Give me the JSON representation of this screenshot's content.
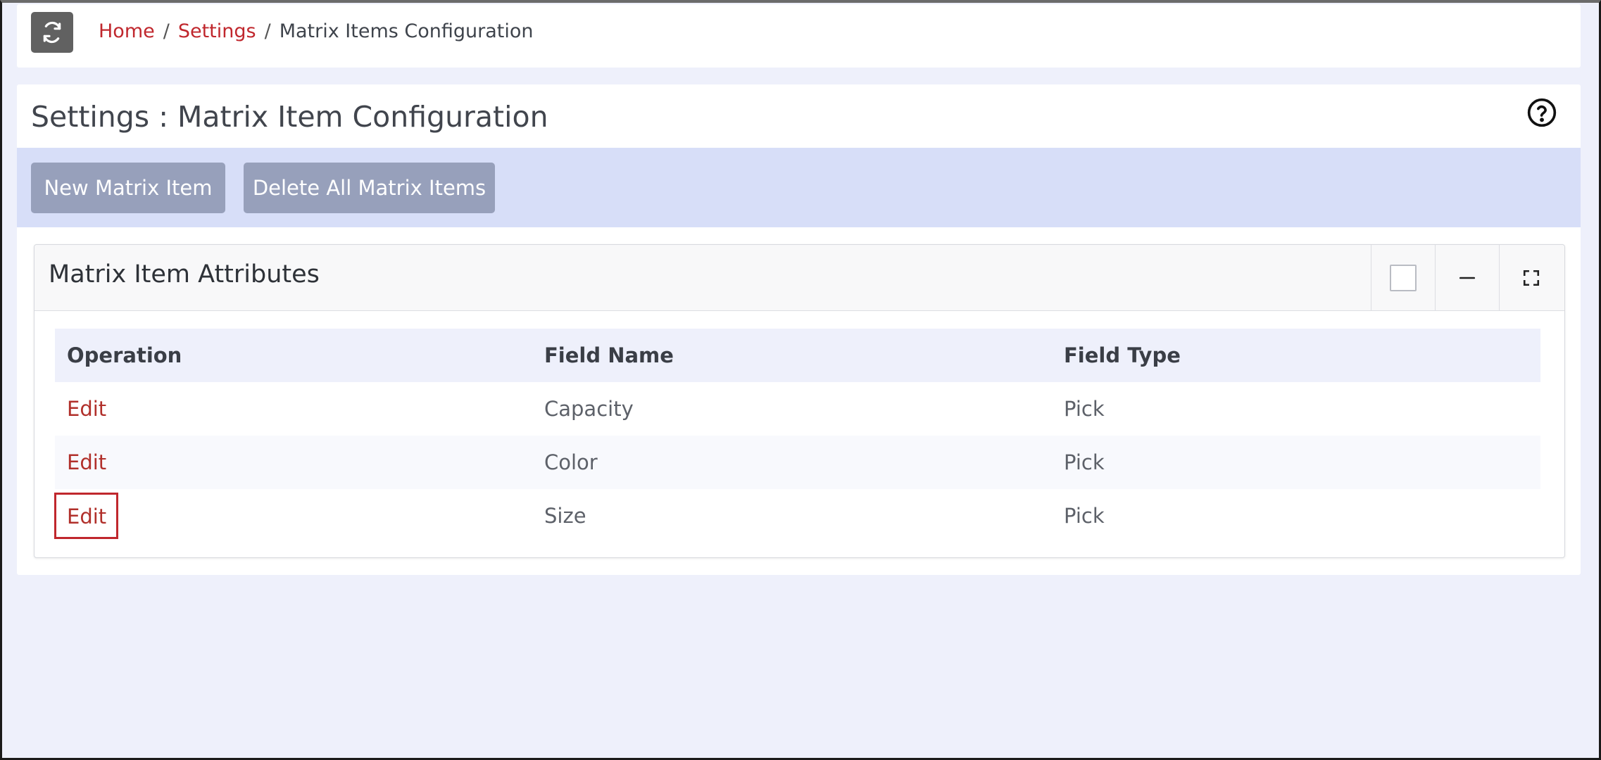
{
  "breadcrumb": {
    "home": "Home",
    "settings": "Settings",
    "separator": "/",
    "current": "Matrix Items Configuration"
  },
  "page": {
    "title": "Settings : Matrix Item Configuration"
  },
  "toolbar": {
    "new_label": "New Matrix Item",
    "delete_label": "Delete All Matrix Items"
  },
  "card": {
    "title": "Matrix Item Attributes"
  },
  "table": {
    "headers": [
      "Operation",
      "Field Name",
      "Field Type"
    ],
    "rows": [
      {
        "operation": "Edit",
        "field_name": "Capacity",
        "field_type": "Pick"
      },
      {
        "operation": "Edit",
        "field_name": "Color",
        "field_type": "Pick"
      },
      {
        "operation": "Edit",
        "field_name": "Size",
        "field_type": "Pick"
      }
    ]
  },
  "icons": {
    "refresh": "refresh-icon",
    "help": "help-icon",
    "checkbox": "checkbox-icon",
    "minimize": "minimize-icon",
    "maximize": "maximize-icon"
  },
  "colors": {
    "accent_link": "#c0272d",
    "toolbar_bg": "#d7def8",
    "button_bg": "#97a0bb",
    "page_bg": "#eef0fb"
  }
}
